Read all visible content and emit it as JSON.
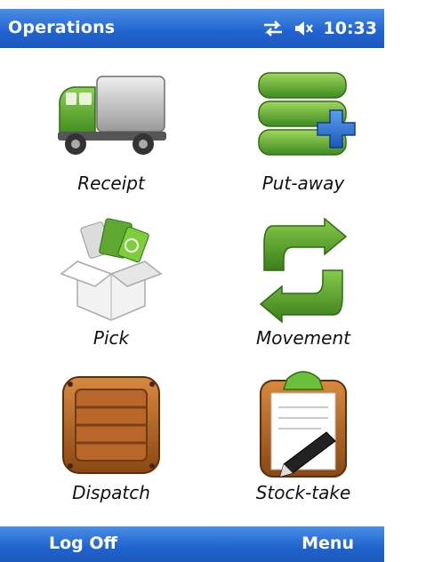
{
  "title_bar": {
    "title": "Operations",
    "time": "10:33",
    "icons": [
      "connectivity-icon",
      "speaker-muted-icon"
    ]
  },
  "tiles": [
    {
      "label": "Receipt",
      "icon": "truck-icon"
    },
    {
      "label": "Put-away",
      "icon": "stack-add-icon"
    },
    {
      "label": "Pick",
      "icon": "open-box-icon"
    },
    {
      "label": "Movement",
      "icon": "green-arrows-icon"
    },
    {
      "label": "Dispatch",
      "icon": "wooden-crate-icon"
    },
    {
      "label": "Stock-take",
      "icon": "clipboard-pen-icon"
    }
  ],
  "softkeys": {
    "left": "Log Off",
    "right": "Menu"
  },
  "colors": {
    "bar_blue": "#1f63cf",
    "icon_green": "#5ea832",
    "crate_brown": "#a35a1e"
  }
}
